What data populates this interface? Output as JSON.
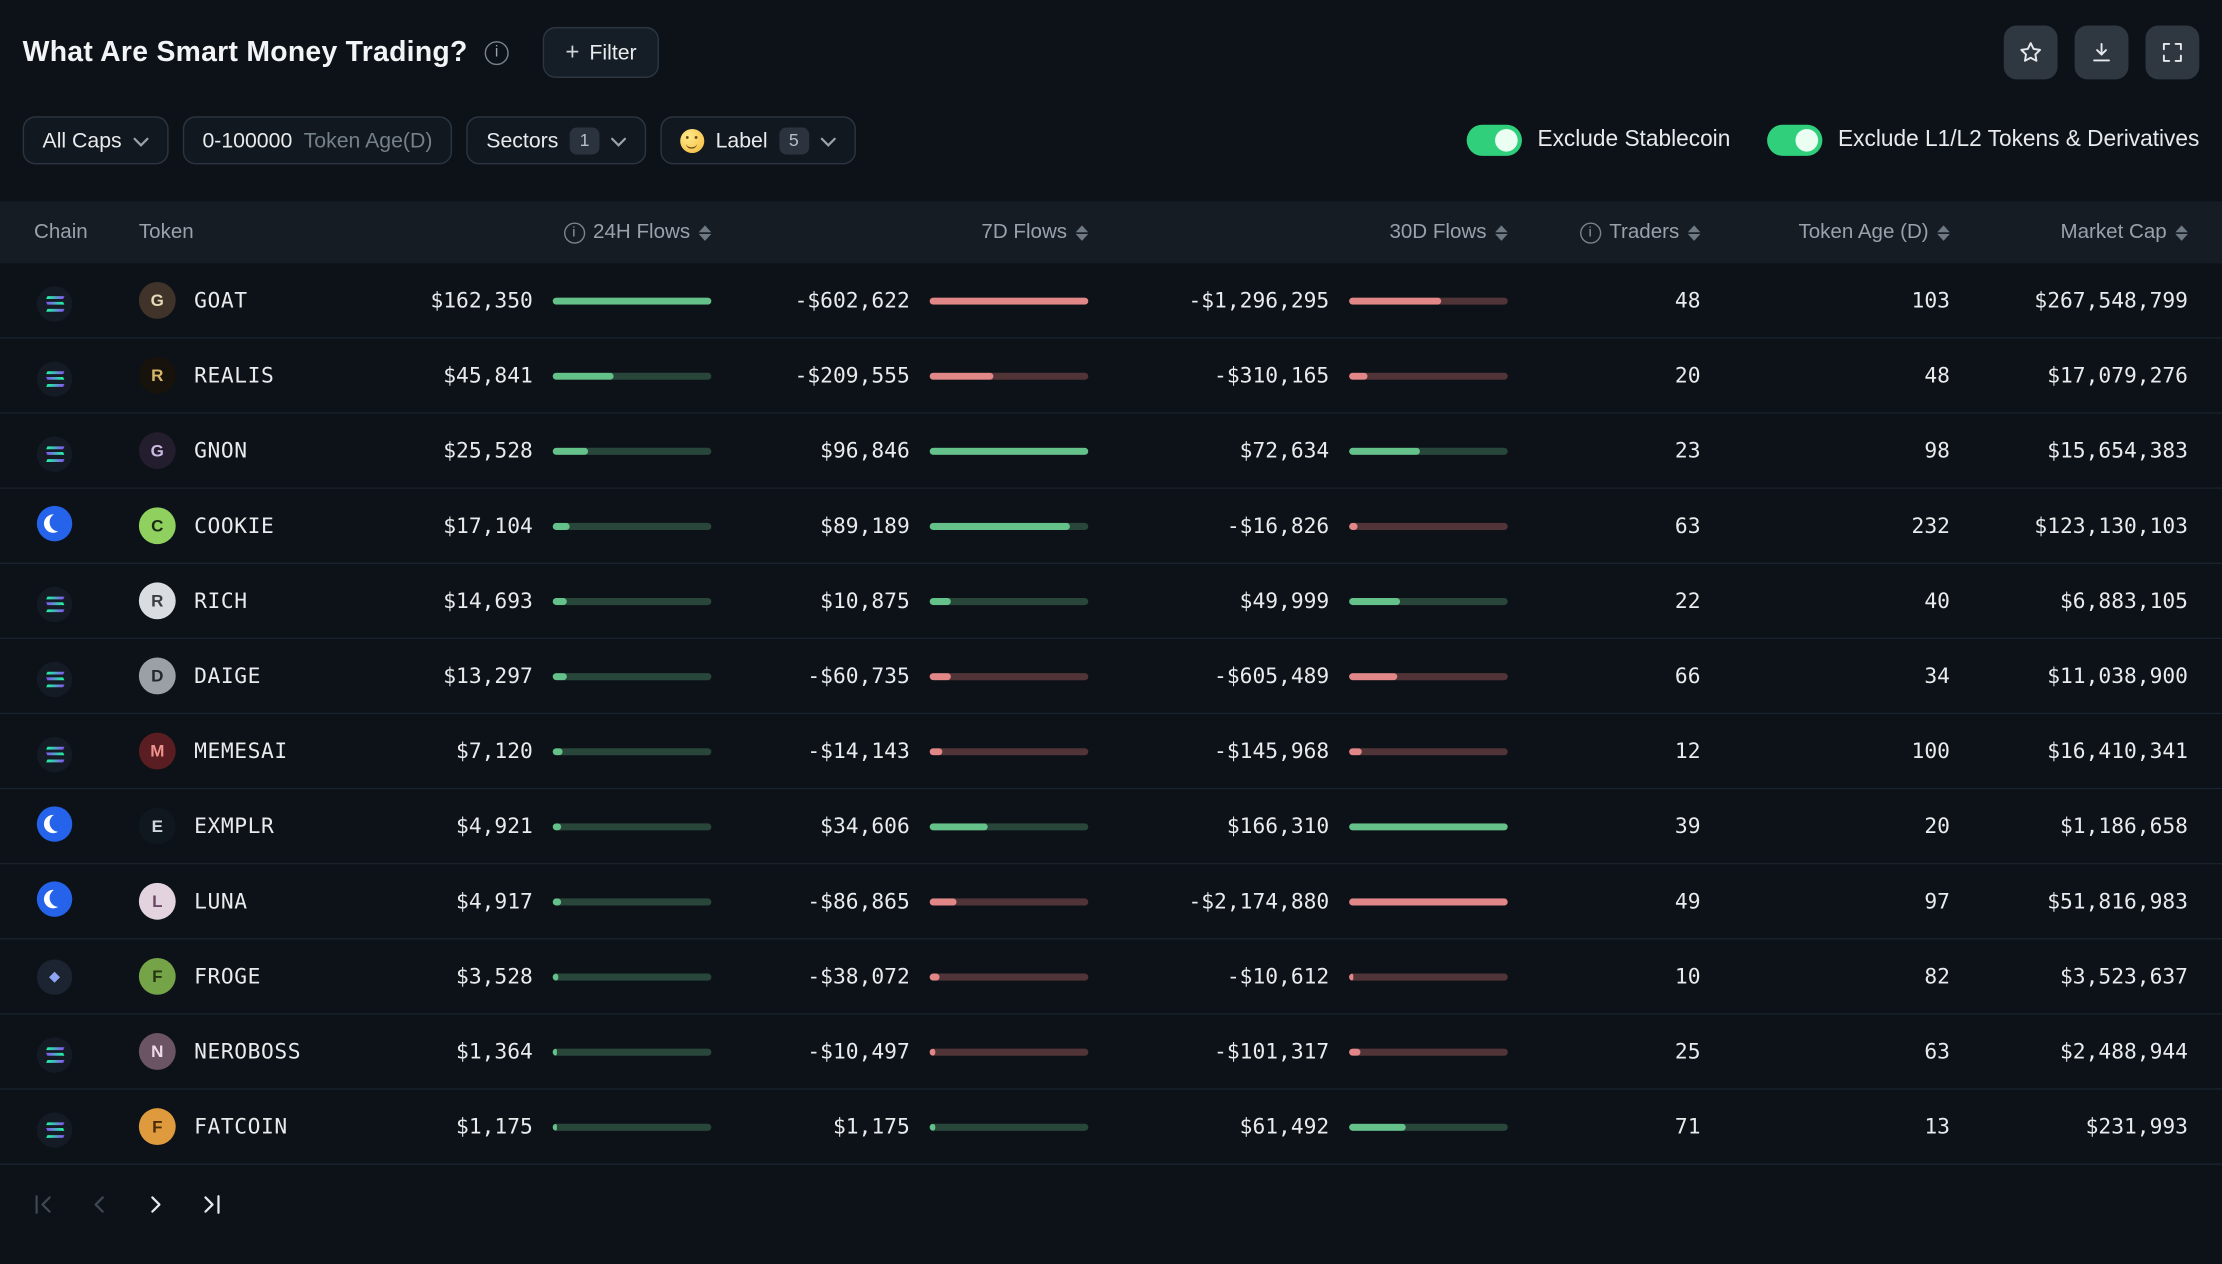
{
  "header": {
    "title": "What Are Smart Money Trading?",
    "filter_plus": "+",
    "filter_button_label": "Filter",
    "action_icons": [
      "star-icon",
      "download-icon",
      "fullscreen-icon"
    ]
  },
  "filters": {
    "all_caps_label": "All Caps",
    "token_age_value": "0-100000",
    "token_age_suffix": "Token Age(D)",
    "sectors_label": "Sectors",
    "sectors_count": "1",
    "label_emoji": "smart-money-face-emoji",
    "label_label": "Label",
    "label_count": "5",
    "exclude_stablecoin_label": "Exclude Stablecoin",
    "exclude_l1l2_label": "Exclude L1/L2 Tokens & Derivatives",
    "exclude_stablecoin_state": "on",
    "exclude_l1l2_state": "on"
  },
  "table": {
    "columns": [
      "Chain",
      "Token",
      "24H Flows",
      "7D Flows",
      "30D Flows",
      "Traders",
      "Token Age (D)",
      "Market Cap"
    ],
    "rows": [
      {
        "chain": "solana",
        "token": "GOAT",
        "avatar": {
          "bg": "#40342a",
          "fg": "#e8d9b8",
          "initial": "G"
        },
        "flows_24h": {
          "text": "$162,350",
          "dir": "pos",
          "pct": 100
        },
        "flows_7d": {
          "text": "-$602,622",
          "dir": "neg",
          "pct": 100
        },
        "flows_30d": {
          "text": "-$1,296,295",
          "dir": "neg",
          "pct": 58
        },
        "traders": "48",
        "token_age": "103",
        "market_cap": "$267,548,799"
      },
      {
        "chain": "solana",
        "token": "REALIS",
        "avatar": {
          "bg": "#17130c",
          "fg": "#d7b66a",
          "initial": "R"
        },
        "flows_24h": {
          "text": "$45,841",
          "dir": "pos",
          "pct": 38
        },
        "flows_7d": {
          "text": "-$209,555",
          "dir": "neg",
          "pct": 40
        },
        "flows_30d": {
          "text": "-$310,165",
          "dir": "neg",
          "pct": 12
        },
        "traders": "20",
        "token_age": "48",
        "market_cap": "$17,079,276"
      },
      {
        "chain": "solana",
        "token": "GNON",
        "avatar": {
          "bg": "#241d2e",
          "fg": "#cbb9e2",
          "initial": "G"
        },
        "flows_24h": {
          "text": "$25,528",
          "dir": "pos",
          "pct": 22
        },
        "flows_7d": {
          "text": "$96,846",
          "dir": "pos",
          "pct": 100
        },
        "flows_30d": {
          "text": "$72,634",
          "dir": "pos",
          "pct": 45
        },
        "traders": "23",
        "token_age": "98",
        "market_cap": "$15,654,383"
      },
      {
        "chain": "base",
        "token": "COOKIE",
        "avatar": {
          "bg": "#8fd05f",
          "fg": "#1c2a12",
          "initial": "C"
        },
        "flows_24h": {
          "text": "$17,104",
          "dir": "pos",
          "pct": 11
        },
        "flows_7d": {
          "text": "$89,189",
          "dir": "pos",
          "pct": 88
        },
        "flows_30d": {
          "text": "-$16,826",
          "dir": "neg",
          "pct": 5
        },
        "traders": "63",
        "token_age": "232",
        "market_cap": "$123,130,103"
      },
      {
        "chain": "solana",
        "token": "RICH",
        "avatar": {
          "bg": "#d9dde2",
          "fg": "#3a3f45",
          "initial": "R"
        },
        "flows_24h": {
          "text": "$14,693",
          "dir": "pos",
          "pct": 9
        },
        "flows_7d": {
          "text": "$10,875",
          "dir": "pos",
          "pct": 13
        },
        "flows_30d": {
          "text": "$49,999",
          "dir": "pos",
          "pct": 32
        },
        "traders": "22",
        "token_age": "40",
        "market_cap": "$6,883,105"
      },
      {
        "chain": "solana",
        "token": "DAIGE",
        "avatar": {
          "bg": "#9aa0a6",
          "fg": "#23272b",
          "initial": "D"
        },
        "flows_24h": {
          "text": "$13,297",
          "dir": "pos",
          "pct": 9
        },
        "flows_7d": {
          "text": "-$60,735",
          "dir": "neg",
          "pct": 13
        },
        "flows_30d": {
          "text": "-$605,489",
          "dir": "neg",
          "pct": 30
        },
        "traders": "66",
        "token_age": "34",
        "market_cap": "$11,038,900"
      },
      {
        "chain": "solana",
        "token": "MEMESAI",
        "avatar": {
          "bg": "#5a1d22",
          "fg": "#f0938e",
          "initial": "M"
        },
        "flows_24h": {
          "text": "$7,120",
          "dir": "pos",
          "pct": 6
        },
        "flows_7d": {
          "text": "-$14,143",
          "dir": "neg",
          "pct": 8
        },
        "flows_30d": {
          "text": "-$145,968",
          "dir": "neg",
          "pct": 8
        },
        "traders": "12",
        "token_age": "100",
        "market_cap": "$16,410,341"
      },
      {
        "chain": "base",
        "token": "EXMPLR",
        "avatar": {
          "bg": "#10181f",
          "fg": "#cfd6dd",
          "initial": "E"
        },
        "flows_24h": {
          "text": "$4,921",
          "dir": "pos",
          "pct": 5
        },
        "flows_7d": {
          "text": "$34,606",
          "dir": "pos",
          "pct": 37
        },
        "flows_30d": {
          "text": "$166,310",
          "dir": "pos",
          "pct": 100
        },
        "traders": "39",
        "token_age": "20",
        "market_cap": "$1,186,658"
      },
      {
        "chain": "base",
        "token": "LUNA",
        "avatar": {
          "bg": "#e3d3de",
          "fg": "#6b4a63",
          "initial": "L"
        },
        "flows_24h": {
          "text": "$4,917",
          "dir": "pos",
          "pct": 5
        },
        "flows_7d": {
          "text": "-$86,865",
          "dir": "neg",
          "pct": 17
        },
        "flows_30d": {
          "text": "-$2,174,880",
          "dir": "neg",
          "pct": 100
        },
        "traders": "49",
        "token_age": "97",
        "market_cap": "$51,816,983"
      },
      {
        "chain": "ethereum",
        "token": "FROGE",
        "avatar": {
          "bg": "#74a348",
          "fg": "#243612",
          "initial": "F"
        },
        "flows_24h": {
          "text": "$3,528",
          "dir": "pos",
          "pct": 4
        },
        "flows_7d": {
          "text": "-$38,072",
          "dir": "neg",
          "pct": 6
        },
        "flows_30d": {
          "text": "-$10,612",
          "dir": "neg",
          "pct": 3
        },
        "traders": "10",
        "token_age": "82",
        "market_cap": "$3,523,637"
      },
      {
        "chain": "solana",
        "token": "NEROBOSS",
        "avatar": {
          "bg": "#6b5565",
          "fg": "#f0dce8",
          "initial": "N"
        },
        "flows_24h": {
          "text": "$1,364",
          "dir": "pos",
          "pct": 3
        },
        "flows_7d": {
          "text": "-$10,497",
          "dir": "neg",
          "pct": 4
        },
        "flows_30d": {
          "text": "-$101,317",
          "dir": "neg",
          "pct": 7
        },
        "traders": "25",
        "token_age": "63",
        "market_cap": "$2,488,944"
      },
      {
        "chain": "solana",
        "token": "FATCOIN",
        "avatar": {
          "bg": "#e09a3e",
          "fg": "#4a2c08",
          "initial": "F"
        },
        "flows_24h": {
          "text": "$1,175",
          "dir": "pos",
          "pct": 3
        },
        "flows_7d": {
          "text": "$1,175",
          "dir": "pos",
          "pct": 4
        },
        "flows_30d": {
          "text": "$61,492",
          "dir": "pos",
          "pct": 36
        },
        "traders": "71",
        "token_age": "13",
        "market_cap": "$231,993"
      }
    ]
  },
  "pagination": {
    "icons": [
      "first-page-icon",
      "previous-page-icon",
      "next-page-icon",
      "last-page-icon"
    ]
  },
  "colors": {
    "background": "#0c1218",
    "accent_green": "#2fcf7c",
    "bar_positive_fill": "#64c189",
    "bar_positive_track": "#29463a",
    "bar_negative_fill": "#e18787",
    "bar_negative_track": "#513437"
  }
}
